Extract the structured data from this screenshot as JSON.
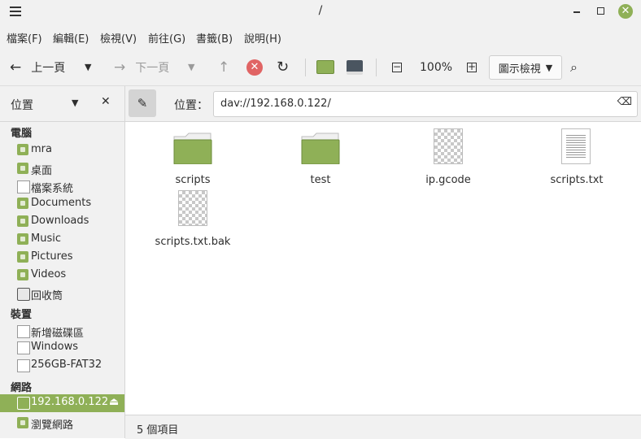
{
  "window": {
    "title": "/"
  },
  "menu": [
    "檔案(F)",
    "編輯(E)",
    "檢視(V)",
    "前往(G)",
    "書籤(B)",
    "說明(H)"
  ],
  "toolbar": {
    "back_label": "上一頁",
    "forward_label": "下一頁",
    "zoom": "100%",
    "view_mode": "圖示檢視"
  },
  "sidebar": {
    "header": "位置",
    "sections": {
      "computer": "電腦",
      "devices": "裝置",
      "network": "網路"
    },
    "computer_items": [
      "mra",
      "桌面",
      "檔案系統",
      "Documents",
      "Downloads",
      "Music",
      "Pictures",
      "Videos",
      "回收筒"
    ],
    "device_items": [
      "新增磁碟區",
      "Windows",
      "256GB-FAT32"
    ],
    "network_items": [
      "192.168.0.122",
      "瀏覽網路"
    ]
  },
  "location": {
    "label": "位置：",
    "value": "dav://192.168.0.122/"
  },
  "files": [
    {
      "name": "scripts",
      "type": "folder"
    },
    {
      "name": "test",
      "type": "folder"
    },
    {
      "name": "ip.gcode",
      "type": "unknown"
    },
    {
      "name": "scripts.txt",
      "type": "text"
    },
    {
      "name": "scripts.txt.bak",
      "type": "unknown"
    }
  ],
  "status": {
    "text": "5 個項目"
  },
  "colors": {
    "accent": "#8fb057",
    "close": "#8fb057",
    "stop": "#e06464"
  }
}
